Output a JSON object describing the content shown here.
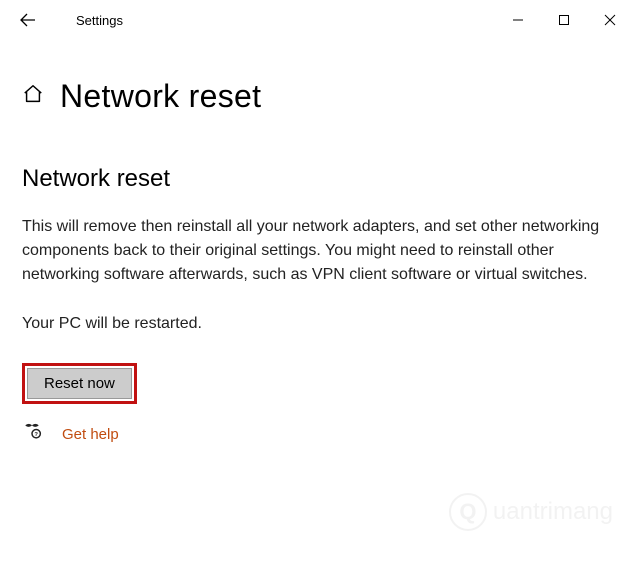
{
  "titlebar": {
    "title": "Settings"
  },
  "page": {
    "heading": "Network reset",
    "section_title": "Network reset",
    "description": "This will remove then reinstall all your network adapters, and set other networking components back to their original settings. You might need to reinstall other networking software afterwards, such as VPN client software or virtual switches.",
    "restart_note": "Your PC will be restarted.",
    "reset_button": "Reset now",
    "help_link": "Get help"
  },
  "watermark": {
    "text": "uantrimang"
  }
}
